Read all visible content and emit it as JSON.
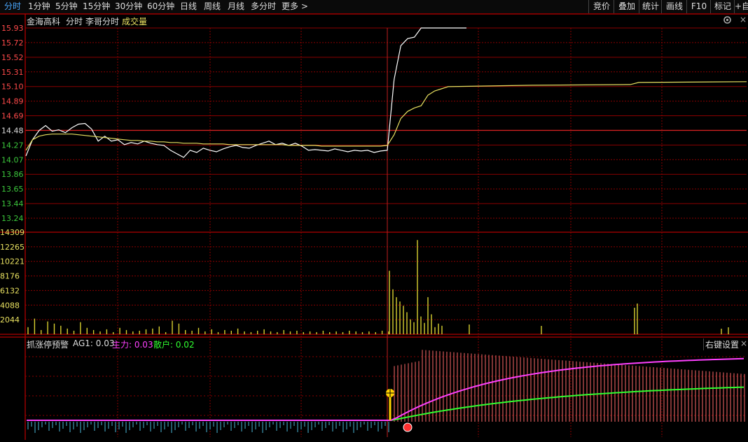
{
  "toolbar": {
    "periods": [
      "分时",
      "1分钟",
      "5分钟",
      "15分钟",
      "30分钟",
      "60分钟",
      "日线",
      "周线",
      "月线",
      "多分时",
      "更多 >"
    ],
    "tools": [
      "竞价",
      "叠加",
      "统计",
      "画线",
      "F10",
      "标记",
      "+自"
    ]
  },
  "stock": {
    "name": "金海高科",
    "mode1": "分时",
    "mode2": "李哥分时",
    "mode3": "成交量"
  },
  "price_axis": [
    "15.93",
    "15.72",
    "15.52",
    "15.31",
    "15.10",
    "14.89",
    "14.69",
    "14.48",
    "14.27",
    "14.07",
    "13.86",
    "13.65",
    "13.44",
    "13.24"
  ],
  "volume_axis": [
    "14309",
    "12265",
    "10221",
    "8176",
    "6132",
    "4088",
    "2044"
  ],
  "indicator": {
    "name": "抓涨停预警",
    "ag1": "AG1: 0.03",
    "main_force": "主力: 0.03",
    "retail": "散户: 0.02",
    "settings": "右键设置",
    "close": "×"
  },
  "colors": {
    "grid": "#8a0000",
    "price_line": "#ffffff",
    "avg_line": "#e8e060",
    "up_axis": "#ff4a4a",
    "down_axis": "#3cc83c",
    "volume": "#d8d030",
    "main_force_line": "#ff40ff",
    "retail_line": "#30ff30",
    "ind_up": "#ff6a6a",
    "ind_down": "#4ab8d8"
  },
  "chart_data": {
    "type": "line",
    "title": "金海高科",
    "prev_close": 14.48,
    "ylim": [
      13.24,
      15.93
    ],
    "series": [
      {
        "name": "price",
        "values": [
          14.12,
          14.35,
          14.48,
          14.55,
          14.47,
          14.49,
          14.45,
          14.52,
          14.57,
          14.58,
          14.5,
          14.33,
          14.4,
          14.33,
          14.35,
          14.28,
          14.31,
          14.29,
          14.33,
          14.3,
          14.28,
          14.27,
          14.2,
          14.15,
          14.1,
          14.2,
          14.17,
          14.23,
          14.2,
          14.18,
          14.22,
          14.25,
          14.27,
          14.24,
          14.23,
          14.27,
          14.3,
          14.33,
          14.28,
          14.3,
          14.27,
          14.3,
          14.26,
          14.2,
          14.21,
          14.2,
          14.19,
          14.22,
          14.2,
          14.18,
          14.2,
          14.19,
          14.2,
          14.17,
          14.19,
          14.2,
          15.2,
          15.68,
          15.78,
          15.8,
          15.93,
          15.93,
          15.93,
          15.93,
          15.93
        ]
      },
      {
        "name": "average",
        "values": [
          14.2,
          14.35,
          14.4,
          14.42,
          14.43,
          14.43,
          14.43,
          14.43,
          14.42,
          14.41,
          14.4,
          14.39,
          14.38,
          14.37,
          14.36,
          14.35,
          14.34,
          14.34,
          14.33,
          14.33,
          14.32,
          14.32,
          14.31,
          14.31,
          14.3,
          14.3,
          14.3,
          14.29,
          14.29,
          14.29,
          14.29,
          14.28,
          14.28,
          14.28,
          14.28,
          14.28,
          14.28,
          14.28,
          14.28,
          14.28,
          14.27,
          14.27,
          14.27,
          14.27,
          14.27,
          14.26,
          14.26,
          14.26,
          14.26,
          14.26,
          14.26,
          14.26,
          14.26,
          14.26,
          14.26,
          14.27,
          14.42,
          14.65,
          14.75,
          14.8,
          14.83,
          14.98,
          15.04,
          15.07,
          15.1
        ]
      },
      {
        "name": "volume",
        "values": [
          1000,
          2200,
          600,
          1800,
          1500,
          1200,
          800,
          500,
          1700,
          900,
          600,
          400,
          700,
          300,
          900,
          600,
          400,
          500,
          700,
          800,
          1100,
          300,
          1900,
          1500,
          600,
          500,
          900,
          400,
          700,
          300,
          600,
          500,
          800,
          400,
          300,
          500,
          700,
          400,
          300,
          600,
          400,
          500,
          300,
          400,
          300,
          500,
          300,
          400,
          300,
          500,
          400,
          300,
          400,
          300,
          500,
          400,
          8900,
          6300,
          5200,
          4600,
          4000,
          3100,
          2100,
          1700,
          13200,
          2500,
          1600,
          5200,
          2800,
          1000,
          1500,
          1200
        ]
      }
    ]
  }
}
